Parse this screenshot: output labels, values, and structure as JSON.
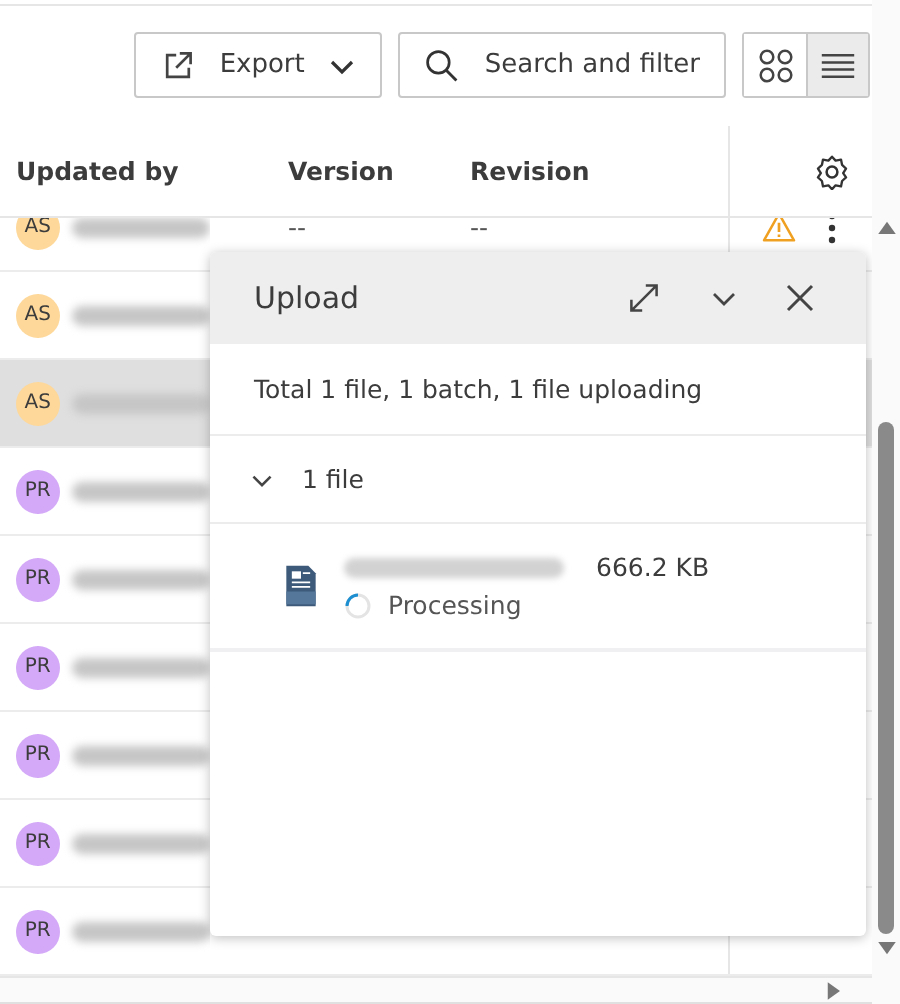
{
  "toolbar": {
    "export_label": "Export",
    "search_label": "Search and filter",
    "views": [
      {
        "kind": "grid",
        "selected": false
      },
      {
        "kind": "list",
        "selected": true
      }
    ]
  },
  "table": {
    "columns": [
      "Updated by",
      "Version",
      "Revision"
    ],
    "rows": [
      {
        "initials": "AS",
        "color": "#fdd89a",
        "version": "--",
        "revision": "--",
        "warning": true,
        "selected": false
      },
      {
        "initials": "AS",
        "color": "#fdd89a",
        "warning": false,
        "selected": false
      },
      {
        "initials": "AS",
        "color": "#fdd89a",
        "warning": false,
        "selected": true
      },
      {
        "initials": "PR",
        "color": "#d4a9f7",
        "warning": false,
        "selected": false
      },
      {
        "initials": "PR",
        "color": "#d4a9f7",
        "warning": false,
        "selected": false
      },
      {
        "initials": "PR",
        "color": "#d4a9f7",
        "warning": false,
        "selected": false
      },
      {
        "initials": "PR",
        "color": "#d4a9f7",
        "warning": false,
        "selected": false
      },
      {
        "initials": "PR",
        "color": "#d4a9f7",
        "warning": false,
        "selected": false
      },
      {
        "initials": "PR",
        "color": "#d4a9f7",
        "warning": false,
        "selected": false
      }
    ]
  },
  "upload": {
    "title": "Upload",
    "summary": "Total 1 file, 1 batch, 1 file uploading",
    "group": {
      "label": "1 file",
      "expanded": true
    },
    "files": [
      {
        "size": "666.2 KB",
        "status": "Processing"
      }
    ]
  }
}
